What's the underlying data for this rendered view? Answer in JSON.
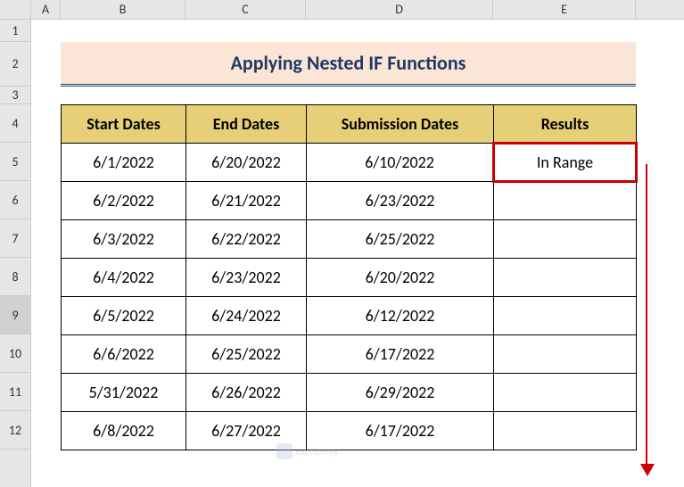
{
  "columns": [
    "A",
    "B",
    "C",
    "D",
    "E"
  ],
  "rows": [
    "1",
    "2",
    "3",
    "4",
    "5",
    "6",
    "7",
    "8",
    "9",
    "10",
    "11",
    "12"
  ],
  "title": "Applying Nested IF Functions",
  "headers": {
    "col_b": "Start Dates",
    "col_c": "End Dates",
    "col_d": "Submission Dates",
    "col_e": "Results"
  },
  "chart_data": {
    "type": "table",
    "title": "Applying Nested IF Functions",
    "columns": [
      "Start Dates",
      "End Dates",
      "Submission Dates",
      "Results"
    ],
    "rows": [
      {
        "start": "6/1/2022",
        "end": "6/20/2022",
        "submission": "6/10/2022",
        "result": "In Range"
      },
      {
        "start": "6/2/2022",
        "end": "6/21/2022",
        "submission": "6/23/2022",
        "result": ""
      },
      {
        "start": "6/3/2022",
        "end": "6/22/2022",
        "submission": "6/25/2022",
        "result": ""
      },
      {
        "start": "6/4/2022",
        "end": "6/23/2022",
        "submission": "6/20/2022",
        "result": ""
      },
      {
        "start": "6/5/2022",
        "end": "6/24/2022",
        "submission": "6/12/2022",
        "result": ""
      },
      {
        "start": "6/6/2022",
        "end": "6/25/2022",
        "submission": "6/17/2022",
        "result": ""
      },
      {
        "start": "5/31/2022",
        "end": "6/26/2022",
        "submission": "6/29/2022",
        "result": ""
      },
      {
        "start": "6/8/2022",
        "end": "6/27/2022",
        "submission": "6/17/2022",
        "result": ""
      }
    ]
  },
  "watermark": "exceldemy",
  "selected_row": "9"
}
